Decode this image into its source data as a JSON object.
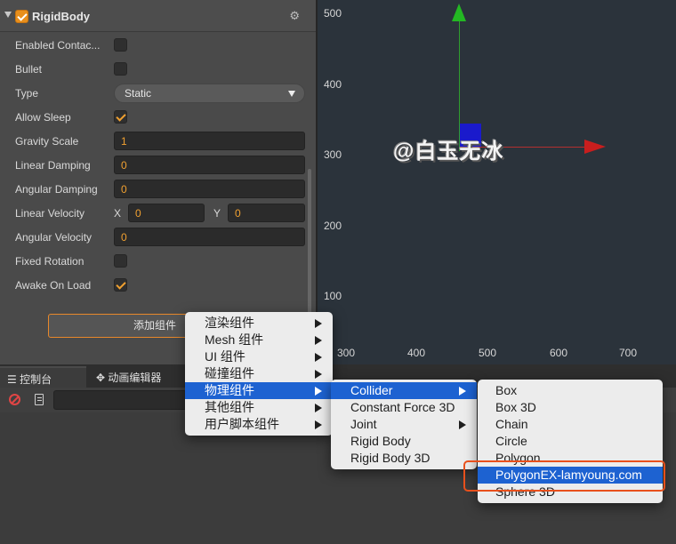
{
  "inspector": {
    "component_title": "RigidBody",
    "props": {
      "enabled_contact": {
        "label": "Enabled Contac...",
        "checked": false
      },
      "bullet": {
        "label": "Bullet",
        "checked": false
      },
      "type": {
        "label": "Type",
        "value": "Static"
      },
      "allow_sleep": {
        "label": "Allow Sleep",
        "checked": true
      },
      "gravity_scale": {
        "label": "Gravity Scale",
        "value": "1"
      },
      "linear_damping": {
        "label": "Linear Damping",
        "value": "0"
      },
      "angular_damping": {
        "label": "Angular Damping",
        "value": "0"
      },
      "linear_velocity": {
        "label": "Linear Velocity",
        "x_label": "X",
        "x_value": "0",
        "y_label": "Y",
        "y_value": "0"
      },
      "angular_velocity": {
        "label": "Angular Velocity",
        "value": "0"
      },
      "fixed_rotation": {
        "label": "Fixed Rotation",
        "checked": false
      },
      "awake_on_load": {
        "label": "Awake On Load",
        "checked": true
      }
    },
    "add_component_label": "添加组件"
  },
  "scene": {
    "y_ticks": [
      "500",
      "400",
      "300",
      "200",
      "100"
    ],
    "x_ticks": [
      "300",
      "400",
      "500",
      "600",
      "700"
    ],
    "watermark": "@白玉无冰",
    "colors": {
      "background": "#2b333b",
      "x_axis": "#c81e1e",
      "y_axis": "#23b823",
      "node": "#1a1acc"
    }
  },
  "bottom_panel": {
    "tabs": [
      "控制台",
      "动画编辑器"
    ]
  },
  "menus": {
    "level1": [
      "渲染组件",
      "Mesh 组件",
      "UI 组件",
      "碰撞组件",
      "物理组件",
      "其他组件",
      "用户脚本组件"
    ],
    "level1_selected": "物理组件",
    "level2": [
      "Collider",
      "Constant Force 3D",
      "Joint",
      "Rigid Body",
      "Rigid Body 3D"
    ],
    "level2_selected": "Collider",
    "level3": [
      "Box",
      "Box 3D",
      "Chain",
      "Circle",
      "Polygon",
      "PolygonEX-lamyoung.com",
      "Sphere 3D"
    ],
    "level3_selected": "PolygonEX-lamyoung.com"
  },
  "accent_color": "#1d62d1",
  "highlight_color": "#e8501c"
}
